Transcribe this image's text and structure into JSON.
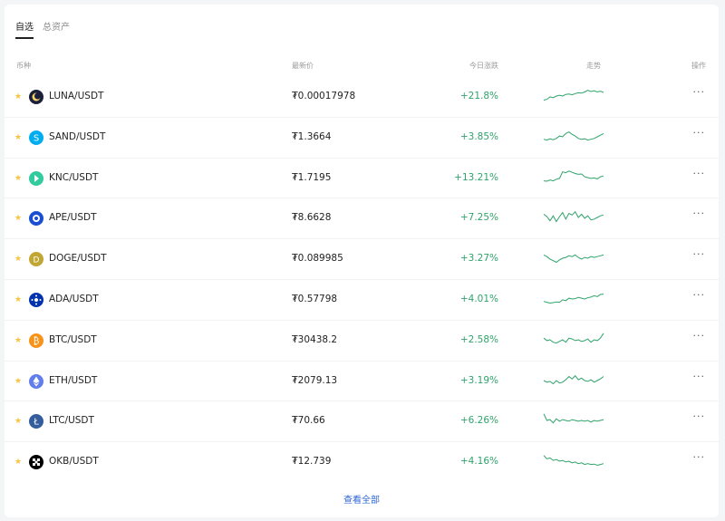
{
  "tabs": [
    {
      "label": "自选",
      "active": true
    },
    {
      "label": "总资产",
      "active": false
    }
  ],
  "columns": {
    "coin": "币种",
    "price": "最新价",
    "change": "今日涨跌",
    "trend": "走势",
    "action": "操作"
  },
  "accent_color": "#2fa36b",
  "rows": [
    {
      "pair": "LUNA/USDT",
      "price": "₮0.00017978",
      "change": "+21.8%",
      "icon": "luna-icon",
      "icon_color": "#1b1f3a",
      "spark": [
        0.25,
        0.3,
        0.45,
        0.4,
        0.5,
        0.55,
        0.5,
        0.6,
        0.62,
        0.58,
        0.65,
        0.7,
        0.68,
        0.75,
        0.85,
        0.78,
        0.82,
        0.75,
        0.8,
        0.72
      ]
    },
    {
      "pair": "SAND/USDT",
      "price": "₮1.3664",
      "change": "+3.85%",
      "icon": "sand-icon",
      "icon_color": "#00adef",
      "spark": [
        0.35,
        0.3,
        0.38,
        0.32,
        0.4,
        0.55,
        0.5,
        0.7,
        0.8,
        0.65,
        0.55,
        0.4,
        0.35,
        0.38,
        0.3,
        0.35,
        0.4,
        0.5,
        0.6,
        0.7
      ]
    },
    {
      "pair": "KNC/USDT",
      "price": "₮1.7195",
      "change": "+13.21%",
      "icon": "knc-icon",
      "icon_color": "#31cb9e",
      "spark": [
        0.3,
        0.28,
        0.35,
        0.3,
        0.4,
        0.45,
        0.85,
        0.8,
        0.9,
        0.82,
        0.75,
        0.7,
        0.72,
        0.55,
        0.5,
        0.45,
        0.48,
        0.42,
        0.55,
        0.6
      ]
    },
    {
      "pair": "APE/USDT",
      "price": "₮8.6628",
      "change": "+7.25%",
      "icon": "ape-icon",
      "icon_color": "#1b4fd1",
      "spark": [
        0.7,
        0.55,
        0.3,
        0.6,
        0.25,
        0.55,
        0.8,
        0.4,
        0.75,
        0.65,
        0.85,
        0.5,
        0.7,
        0.45,
        0.6,
        0.35,
        0.4,
        0.5,
        0.6,
        0.65
      ]
    },
    {
      "pair": "DOGE/USDT",
      "price": "₮0.089985",
      "change": "+3.27%",
      "icon": "doge-icon",
      "icon_color": "#c2a633",
      "spark": [
        0.7,
        0.6,
        0.45,
        0.35,
        0.25,
        0.4,
        0.5,
        0.55,
        0.65,
        0.6,
        0.7,
        0.55,
        0.45,
        0.55,
        0.5,
        0.6,
        0.55,
        0.6,
        0.65,
        0.7
      ]
    },
    {
      "pair": "ADA/USDT",
      "price": "₮0.57798",
      "change": "+4.01%",
      "icon": "ada-icon",
      "icon_color": "#0033ad",
      "spark": [
        0.35,
        0.3,
        0.25,
        0.28,
        0.32,
        0.3,
        0.45,
        0.4,
        0.55,
        0.5,
        0.52,
        0.6,
        0.55,
        0.5,
        0.58,
        0.62,
        0.7,
        0.65,
        0.78,
        0.8
      ]
    },
    {
      "pair": "BTC/USDT",
      "price": "₮30438.2",
      "change": "+2.58%",
      "icon": "btc-icon",
      "icon_color": "#f7931a",
      "spark": [
        0.6,
        0.45,
        0.5,
        0.35,
        0.3,
        0.4,
        0.5,
        0.35,
        0.6,
        0.55,
        0.45,
        0.5,
        0.4,
        0.45,
        0.55,
        0.35,
        0.5,
        0.45,
        0.6,
        0.9
      ]
    },
    {
      "pair": "ETH/USDT",
      "price": "₮2079.13",
      "change": "+3.19%",
      "icon": "eth-icon",
      "icon_color": "#627eea",
      "spark": [
        0.5,
        0.4,
        0.45,
        0.3,
        0.5,
        0.35,
        0.4,
        0.55,
        0.75,
        0.6,
        0.8,
        0.55,
        0.65,
        0.5,
        0.45,
        0.55,
        0.4,
        0.5,
        0.6,
        0.75
      ]
    },
    {
      "pair": "LTC/USDT",
      "price": "₮70.66",
      "change": "+6.26%",
      "icon": "ltc-icon",
      "icon_color": "#345d9d",
      "spark": [
        0.9,
        0.5,
        0.55,
        0.35,
        0.6,
        0.45,
        0.55,
        0.5,
        0.45,
        0.55,
        0.5,
        0.45,
        0.5,
        0.45,
        0.5,
        0.4,
        0.5,
        0.45,
        0.5,
        0.55
      ]
    },
    {
      "pair": "OKB/USDT",
      "price": "₮12.739",
      "change": "+4.16%",
      "icon": "okb-icon",
      "icon_color": "#000000",
      "spark": [
        0.85,
        0.65,
        0.7,
        0.55,
        0.6,
        0.5,
        0.55,
        0.45,
        0.5,
        0.4,
        0.45,
        0.35,
        0.4,
        0.3,
        0.35,
        0.3,
        0.32,
        0.25,
        0.3,
        0.35
      ]
    }
  ],
  "footer": {
    "view_all": "查看全部"
  }
}
